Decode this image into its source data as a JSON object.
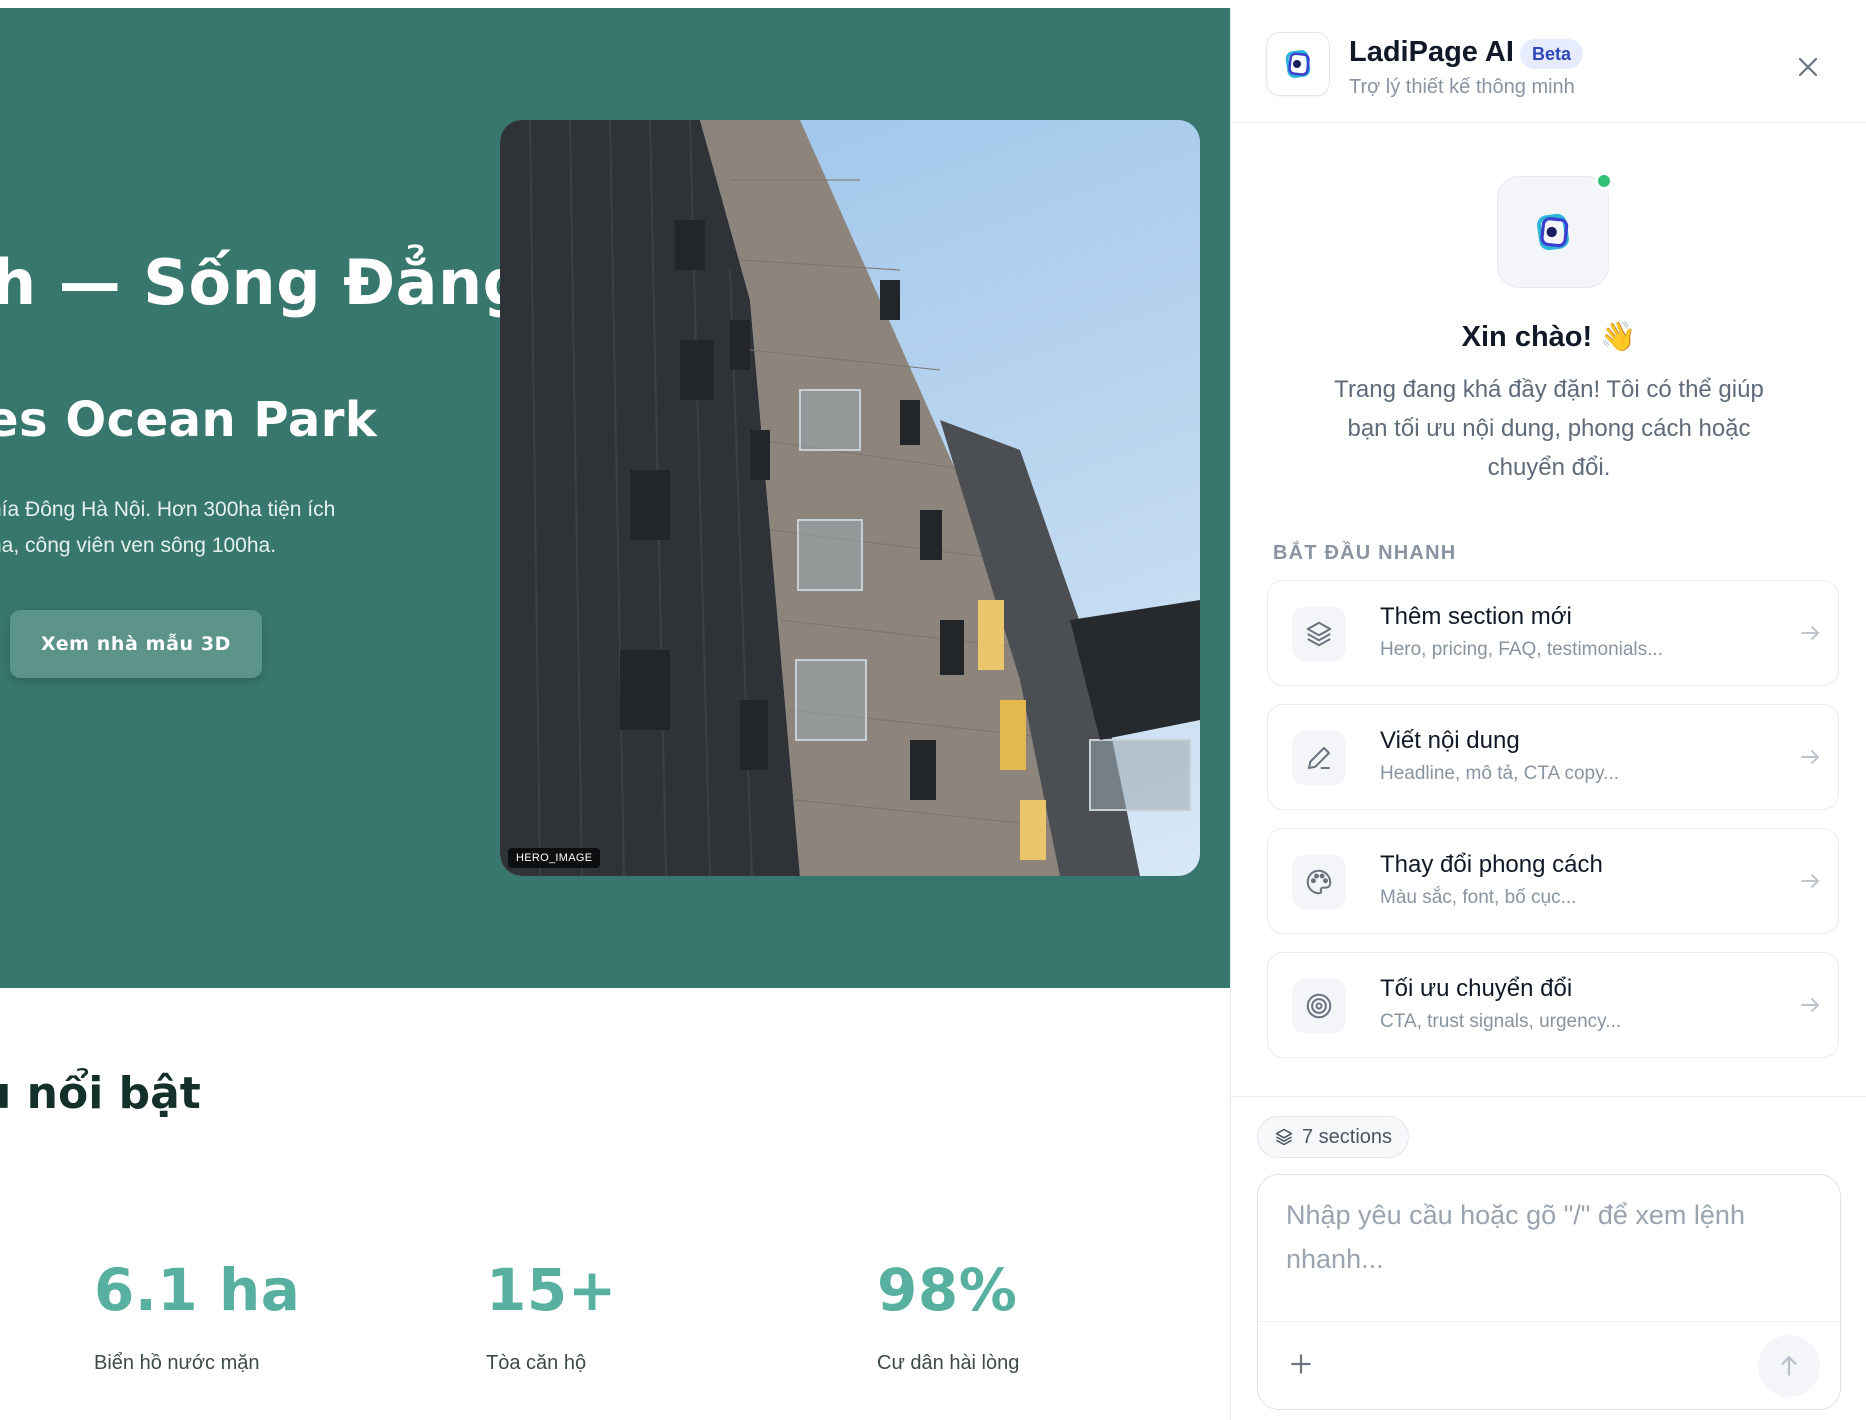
{
  "canvas": {
    "hero": {
      "title": "h — Sống Đẳng",
      "subtitle": "es Ocean Park",
      "description_lines": [
        "hía Đông Hà Nội. Hơn 300ha tiện ích",
        "ha, công viên ven sông 100ha."
      ],
      "cta_label": "Xem nhà mẫu 3D",
      "image_tag": "HERO_IMAGE",
      "background_color": "#38776d"
    },
    "features": {
      "title": "u nổi bật",
      "stats": [
        {
          "value": "6.1 ha",
          "label": "Biển hồ nước mặn"
        },
        {
          "value": "15+",
          "label": "Tòa căn hộ"
        },
        {
          "value": "98%",
          "label": "Cư dân hài lòng"
        }
      ],
      "accent_color": "#57b0a0"
    }
  },
  "panel": {
    "header": {
      "title": "LadiPage AI",
      "badge": "Beta",
      "subtitle": "Trợ lý thiết kế thông minh",
      "logo_icon": "ladipage-logo-icon",
      "close_icon": "close-icon"
    },
    "welcome": {
      "greeting": "Xin chào! 👋",
      "intro_lines": [
        "Trang đang khá đầy đặn! Tôi có thể giúp",
        "bạn tối ưu nội dung, phong cách hoặc",
        "chuyển đổi."
      ]
    },
    "quick_start": {
      "label": "BẮT ĐẦU NHANH",
      "items": [
        {
          "icon": "layers-icon",
          "title": "Thêm section mới",
          "description": "Hero, pricing, FAQ, testimonials..."
        },
        {
          "icon": "pencil-icon",
          "title": "Viết nội dung",
          "description": "Headline, mô tả, CTA copy..."
        },
        {
          "icon": "palette-icon",
          "title": "Thay đổi phong cách",
          "description": "Màu sắc, font, bố cục..."
        },
        {
          "icon": "target-icon",
          "title": "Tối ưu chuyển đổi",
          "description": "CTA, trust signals, urgency..."
        }
      ]
    },
    "composer": {
      "sections_chip": "7 sections",
      "input_value": "",
      "placeholder": "Nhập yêu cầu hoặc gõ \"/\" để xem lệnh nhanh...",
      "add_icon": "plus-icon",
      "send_icon": "arrow-up-icon"
    },
    "colors": {
      "online": "#34c27a",
      "badge_bg": "#e6ecfd",
      "badge_text": "#2d47b8"
    }
  }
}
